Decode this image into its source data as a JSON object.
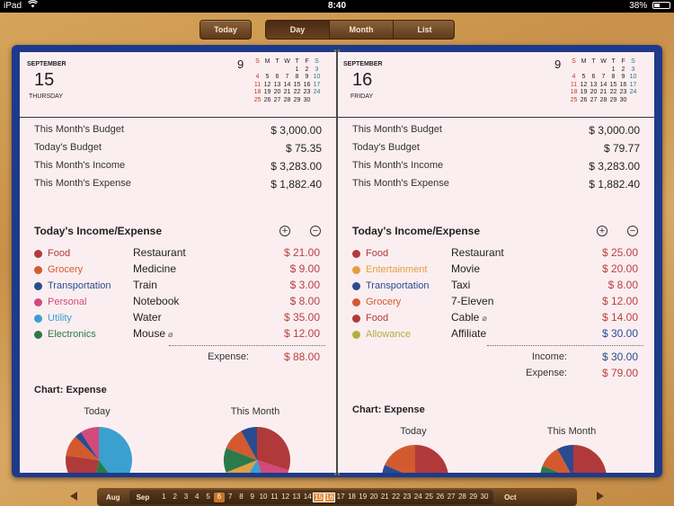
{
  "status": {
    "device": "iPad",
    "wifi_icon": "wifi-icon",
    "time": "8:40",
    "battery": "38%",
    "battery_level": 0.38
  },
  "toolbar": {
    "today": "Today",
    "segments": [
      "Day",
      "Month",
      "List"
    ],
    "active_segment": "Day"
  },
  "left_page": {
    "month": "SEPTEMBER",
    "day": "15",
    "weekday": "THURSDAY",
    "cal_month_num": "9",
    "summary": [
      {
        "label": "This Month's Budget",
        "value": "$ 3,000.00"
      },
      {
        "label": "Today's Budget",
        "value": "$ 75.35"
      },
      {
        "label": "This Month's Income",
        "value": "$ 3,283.00"
      },
      {
        "label": "This Month's Expense",
        "value": "$ 1,882.40"
      }
    ],
    "section_title": "Today's Income/Expense",
    "entries": [
      {
        "category": "Food",
        "desc": "Restaurant",
        "amount": "$ 21.00",
        "color": "#b03a3a",
        "clip": false
      },
      {
        "category": "Grocery",
        "desc": "Medicine",
        "amount": "$ 9.00",
        "color": "#d35a2e",
        "clip": false
      },
      {
        "category": "Transportation",
        "desc": "Train",
        "amount": "$ 3.00",
        "color": "#2b4b8f",
        "clip": false
      },
      {
        "category": "Personal",
        "desc": "Notebook",
        "amount": "$ 8.00",
        "color": "#d24a7a",
        "clip": false
      },
      {
        "category": "Utility",
        "desc": "Water",
        "amount": "$ 35.00",
        "color": "#3aa0d0",
        "clip": false
      },
      {
        "category": "Electronics",
        "desc": "Mouse",
        "amount": "$ 12.00",
        "color": "#2a7a4a",
        "clip": true
      }
    ],
    "totals": [
      {
        "label": "Expense:",
        "value": "$ 88.00",
        "color": "#b84040"
      }
    ],
    "chart_title": "Chart: Expense",
    "pie_labels": [
      "Today",
      "This Month"
    ]
  },
  "right_page": {
    "month": "SEPTEMBER",
    "day": "16",
    "weekday": "FRIDAY",
    "cal_month_num": "9",
    "summary": [
      {
        "label": "This Month's Budget",
        "value": "$ 3,000.00"
      },
      {
        "label": "Today's Budget",
        "value": "$ 79.77"
      },
      {
        "label": "This Month's Income",
        "value": "$ 3,283.00"
      },
      {
        "label": "This Month's Expense",
        "value": "$ 1,882.40"
      }
    ],
    "section_title": "Today's Income/Expense",
    "entries": [
      {
        "category": "Food",
        "desc": "Restaurant",
        "amount": "$ 25.00",
        "color": "#b03a3a",
        "clip": false,
        "amount_color": "#b84040"
      },
      {
        "category": "Entertainment",
        "desc": "Movie",
        "amount": "$ 20.00",
        "color": "#e0a040",
        "clip": false,
        "amount_color": "#b84040"
      },
      {
        "category": "Transportation",
        "desc": "Taxi",
        "amount": "$ 8.00",
        "color": "#2b4b8f",
        "clip": false,
        "amount_color": "#b84040"
      },
      {
        "category": "Grocery",
        "desc": "7-Eleven",
        "amount": "$ 12.00",
        "color": "#d35a2e",
        "clip": false,
        "amount_color": "#b84040"
      },
      {
        "category": "Food",
        "desc": "Cable",
        "amount": "$ 14.00",
        "color": "#b03a3a",
        "clip": true,
        "amount_color": "#b84040"
      },
      {
        "category": "Allowance",
        "desc": "Affiliate",
        "amount": "$ 30.00",
        "color": "#b0b040",
        "clip": false,
        "amount_color": "#2b4b8f"
      }
    ],
    "totals": [
      {
        "label": "Income:",
        "value": "$ 30.00",
        "color": "#2b4b8f"
      },
      {
        "label": "Expense:",
        "value": "$ 79.00",
        "color": "#b84040"
      }
    ],
    "chart_title": "Chart: Expense",
    "pie_labels": [
      "Today",
      "This Month"
    ]
  },
  "mini_calendar": {
    "headers": [
      "S",
      "M",
      "T",
      "W",
      "T",
      "F",
      "S"
    ],
    "weeks": [
      [
        "",
        "",
        "",
        "",
        "1",
        "2",
        "3"
      ],
      [
        "4",
        "5",
        "6",
        "7",
        "8",
        "9",
        "10"
      ],
      [
        "11",
        "12",
        "13",
        "14",
        "15",
        "16",
        "17"
      ],
      [
        "18",
        "19",
        "20",
        "21",
        "22",
        "23",
        "24"
      ],
      [
        "25",
        "26",
        "27",
        "28",
        "29",
        "30",
        ""
      ]
    ]
  },
  "datebar": {
    "prev_month": "Aug",
    "current_month": "Sep",
    "next_month": "Oct",
    "days": [
      "1",
      "2",
      "3",
      "4",
      "5",
      "6",
      "7",
      "8",
      "9",
      "10",
      "11",
      "12",
      "13",
      "14",
      "15",
      "16",
      "17",
      "18",
      "19",
      "20",
      "21",
      "22",
      "23",
      "24",
      "25",
      "26",
      "27",
      "28",
      "29",
      "30"
    ],
    "today_day": "6",
    "selected_days": [
      "15",
      "16"
    ]
  },
  "pie_colors": {
    "left_today": [
      "#3aa0d0",
      "#2a7a4a",
      "#b03a3a",
      "#d35a2e",
      "#2b4b8f",
      "#d24a7a"
    ],
    "left_month": [
      "#b03a3a",
      "#d24a7a",
      "#3aa0d0",
      "#e0a040",
      "#2a7a4a",
      "#d35a2e",
      "#2b4b8f"
    ],
    "right_today": [
      "#b03a3a",
      "#e0a040",
      "#2b4b8f",
      "#d35a2e"
    ],
    "right_month": [
      "#b03a3a",
      "#d24a7a",
      "#3aa0d0",
      "#e0a040",
      "#2a7a4a",
      "#d35a2e",
      "#2b4b8f"
    ]
  }
}
